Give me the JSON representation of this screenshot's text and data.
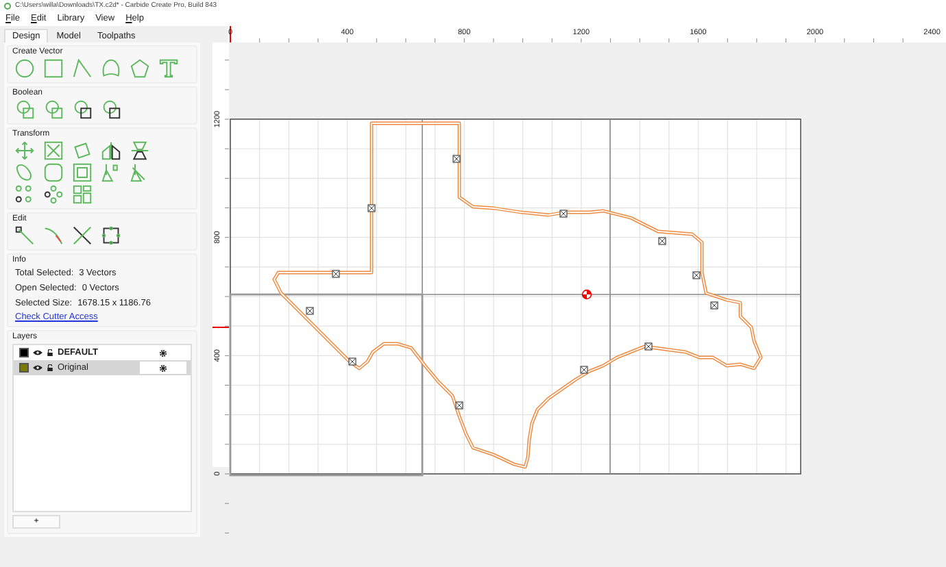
{
  "window": {
    "title": "C:\\Users\\willa\\Downloads\\TX.c2d* - Carbide Create Pro, Build 843"
  },
  "menu": [
    {
      "label": "File",
      "underlined": true
    },
    {
      "label": "Edit",
      "underlined": true
    },
    {
      "label": "Library",
      "underlined": false
    },
    {
      "label": "View",
      "underlined": false
    },
    {
      "label": "Help",
      "underlined": true
    }
  ],
  "tabs": [
    {
      "label": "Design",
      "selected": true
    },
    {
      "label": "Model",
      "selected": false
    },
    {
      "label": "Toolpaths",
      "selected": false
    }
  ],
  "sections": {
    "create_vector": "Create Vector",
    "boolean": "Boolean",
    "transform": "Transform",
    "edit": "Edit",
    "info": "Info",
    "layers": "Layers"
  },
  "info": {
    "rows": [
      {
        "label": "Total Selected:",
        "value": "3 Vectors"
      },
      {
        "label": "Open Selected:",
        "value": "0 Vectors"
      },
      {
        "label": "Selected Size:",
        "value": "1678.15 x 1186.76"
      }
    ],
    "link": "Check Cutter Access"
  },
  "layers": [
    {
      "name": "DEFAULT",
      "color": "#000000",
      "active": true,
      "selected": false
    },
    {
      "name": "Original",
      "color": "#7a7a00",
      "active": false,
      "selected": true
    }
  ],
  "add_button": "+",
  "ruler": {
    "x_labels": [
      "0",
      "400",
      "800",
      "1200",
      "1600",
      "2000",
      "2400"
    ],
    "y_labels": [
      "1200",
      "800",
      "400",
      "0"
    ]
  }
}
